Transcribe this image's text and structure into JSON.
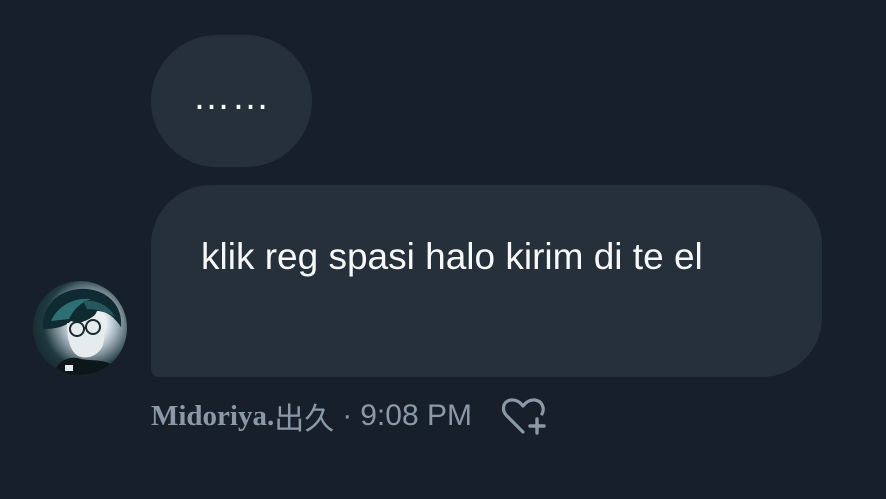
{
  "messages": [
    {
      "text": "……"
    },
    {
      "text": "klik reg spasi halo kirim di te el"
    }
  ],
  "sender": {
    "name": "Midoriya.",
    "name_suffix": "出久"
  },
  "meta": {
    "separator": "·",
    "time": "9:08 PM"
  },
  "icons": {
    "like": "heart-plus-icon",
    "avatar": "avatar"
  },
  "colors": {
    "background": "#17202a",
    "bubble": "#25303a",
    "text": "#f7f9f9",
    "meta_text": "#8b98a5"
  }
}
